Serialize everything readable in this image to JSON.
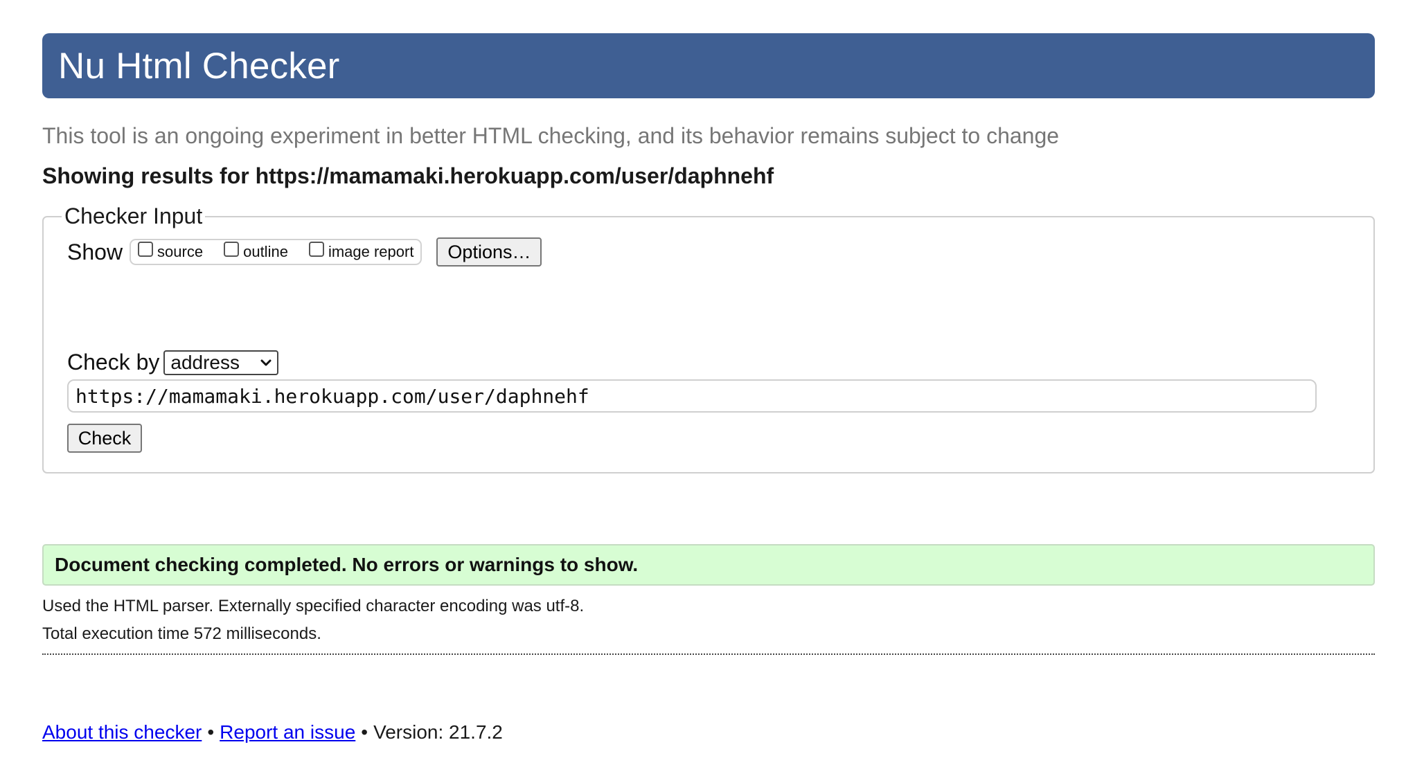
{
  "header": {
    "title": "Nu Html Checker"
  },
  "tagline": "This tool is an ongoing experiment in better HTML checking, and its behavior remains subject to change",
  "results_heading": "Showing results for https://mamamaki.herokuapp.com/user/daphnehf",
  "checker_input": {
    "legend": "Checker Input",
    "show_label": "Show",
    "show_options": [
      {
        "label": "source",
        "checked": false
      },
      {
        "label": "outline",
        "checked": false
      },
      {
        "label": "image report",
        "checked": false
      }
    ],
    "options_button": "Options…",
    "check_by_label": "Check by",
    "check_by_selected": "address",
    "url_value": "https://mamamaki.herokuapp.com/user/daphnehf",
    "check_button": "Check"
  },
  "result": {
    "message": "Document checking completed. No errors or warnings to show.",
    "parser_note": "Used the HTML parser. Externally specified character encoding was utf-8.",
    "execution_time": "Total execution time 572 milliseconds."
  },
  "footer": {
    "about_link": "About this checker",
    "separator": "•",
    "report_link": "Report an issue",
    "version": "Version: 21.7.2"
  },
  "colors": {
    "banner": "#3f5f93",
    "success_bg": "#d7fdd3",
    "link": "#0000ee"
  }
}
